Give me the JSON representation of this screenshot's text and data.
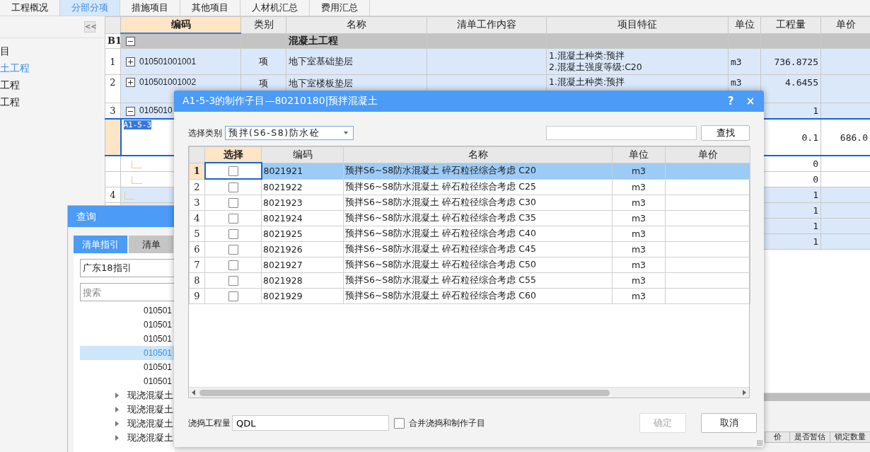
{
  "tabs": [
    {
      "label": "工程概况",
      "selected": false
    },
    {
      "label": "分部分项",
      "selected": true
    },
    {
      "label": "措施项目",
      "selected": false
    },
    {
      "label": "其他项目",
      "selected": false
    },
    {
      "label": "人材机汇总",
      "selected": false
    },
    {
      "label": "费用汇总",
      "selected": false
    }
  ],
  "left_panel": {
    "collapse": "<<",
    "items": [
      {
        "label": "目",
        "selected": false
      },
      {
        "label": "土工程",
        "selected": true
      },
      {
        "label": "工程",
        "selected": false
      },
      {
        "label": "工程",
        "selected": false
      }
    ]
  },
  "grid": {
    "columns": [
      {
        "label": "编码",
        "selected": true
      },
      {
        "label": "类别",
        "selected": false
      },
      {
        "label": "名称",
        "selected": false
      },
      {
        "label": "清单工作内容",
        "selected": false
      },
      {
        "label": "项目特征",
        "selected": false
      },
      {
        "label": "单位",
        "selected": false
      },
      {
        "label": "工程量",
        "selected": false
      },
      {
        "label": "单价",
        "selected": false
      }
    ],
    "rows": [
      {
        "kind": "section",
        "index": "B1",
        "expanded": true,
        "name": "混凝土工程"
      },
      {
        "kind": "item",
        "index": "1",
        "expanded": false,
        "code": "010501001001",
        "type": "项",
        "name": "地下室基础垫层",
        "features": [
          "1.混凝土种类:预拌",
          "2.混凝土强度等级:C20"
        ],
        "unit": "m3",
        "qty": "736.8725"
      },
      {
        "kind": "item",
        "index": "2",
        "expanded": false,
        "code": "010501001002",
        "type": "项",
        "name": "地下室楼板垫层",
        "features": [
          "1.混凝土种类:预拌"
        ],
        "unit": "m3",
        "qty": "4.6455"
      },
      {
        "kind": "item",
        "index": "3",
        "expanded": true,
        "code": "0105010",
        "qty": "1"
      },
      {
        "kind": "quota",
        "code": "A1-5-3",
        "qty": "0.1",
        "price": "686.0"
      },
      {
        "kind": "sub",
        "qty": "0"
      },
      {
        "kind": "sub",
        "qty": "0"
      },
      {
        "kind": "item",
        "index": "4",
        "qty": "1"
      },
      {
        "kind": "item",
        "qty": "1"
      },
      {
        "kind": "item",
        "qty": "1"
      },
      {
        "kind": "item",
        "qty": "1"
      }
    ]
  },
  "bottom_grid": {
    "columns": [
      "价",
      "是否暂估",
      "锁定数量"
    ]
  },
  "query_dialog": {
    "title": "查询",
    "tabs": [
      {
        "label": "清单指引",
        "selected": true
      },
      {
        "label": "清单",
        "selected": false
      }
    ],
    "library": "广东18指引",
    "search": {
      "placeholder": "搜索"
    },
    "tree": [
      {
        "kind": "code",
        "label": "010501",
        "selected": false
      },
      {
        "kind": "code",
        "label": "010501",
        "selected": false
      },
      {
        "kind": "code",
        "label": "010501",
        "selected": false
      },
      {
        "kind": "code",
        "label": "010501",
        "selected": true
      },
      {
        "kind": "code",
        "label": "010501",
        "selected": false
      },
      {
        "kind": "code",
        "label": "010501",
        "selected": false
      },
      {
        "kind": "group",
        "label": "现浇混凝土",
        "selected": false
      },
      {
        "kind": "group",
        "label": "现浇混凝土",
        "selected": false
      },
      {
        "kind": "group",
        "label": "现浇混凝土",
        "selected": false
      },
      {
        "kind": "group",
        "label": "现浇混凝土",
        "selected": false
      }
    ]
  },
  "dialog": {
    "title": "A1-5-3的制作子目—80210180|预拌混凝土",
    "help": "?",
    "close": "×",
    "category_label": "选择类别",
    "category": "预拌(S6-S8)防水砼",
    "find_button": "查找",
    "columns": [
      {
        "label": "选择",
        "selected": true
      },
      {
        "label": "编码",
        "selected": false
      },
      {
        "label": "名称",
        "selected": false
      },
      {
        "label": "单位",
        "selected": false
      },
      {
        "label": "单价",
        "selected": false
      }
    ],
    "rows": [
      {
        "index": "1",
        "selected": true,
        "checked": false,
        "code": "8021921",
        "name": "预拌S6~S8防水混凝土 碎石粒径综合考虑 C20",
        "unit": "m3"
      },
      {
        "index": "2",
        "selected": false,
        "checked": false,
        "code": "8021922",
        "name": "预拌S6~S8防水混凝土 碎石粒径综合考虑 C25",
        "unit": "m3"
      },
      {
        "index": "3",
        "selected": false,
        "checked": false,
        "code": "8021923",
        "name": "预拌S6~S8防水混凝土 碎石粒径综合考虑 C30",
        "unit": "m3"
      },
      {
        "index": "4",
        "selected": false,
        "checked": false,
        "code": "8021924",
        "name": "预拌S6~S8防水混凝土 碎石粒径综合考虑 C35",
        "unit": "m3"
      },
      {
        "index": "5",
        "selected": false,
        "checked": false,
        "code": "8021925",
        "name": "预拌S6~S8防水混凝土 碎石粒径综合考虑 C40",
        "unit": "m3"
      },
      {
        "index": "6",
        "selected": false,
        "checked": false,
        "code": "8021926",
        "name": "预拌S6~S8防水混凝土 碎石粒径综合考虑 C45",
        "unit": "m3"
      },
      {
        "index": "7",
        "selected": false,
        "checked": false,
        "code": "8021927",
        "name": "预拌S6~S8防水混凝土 碎石粒径综合考虑 C50",
        "unit": "m3"
      },
      {
        "index": "8",
        "selected": false,
        "checked": false,
        "code": "8021928",
        "name": "预拌S6~S8防水混凝土 碎石粒径综合考虑 C55",
        "unit": "m3"
      },
      {
        "index": "9",
        "selected": false,
        "checked": false,
        "code": "8021929",
        "name": "预拌S6~S8防水混凝土 碎石粒径综合考虑 C60",
        "unit": "m3"
      }
    ],
    "qty_label": "浇捣工程量",
    "qty_value": "QDL",
    "merge": {
      "label": "合并浇捣和制作子目",
      "checked": false
    },
    "buttons": [
      {
        "label": "确定",
        "disabled": true
      },
      {
        "label": "取消",
        "disabled": false
      }
    ]
  }
}
